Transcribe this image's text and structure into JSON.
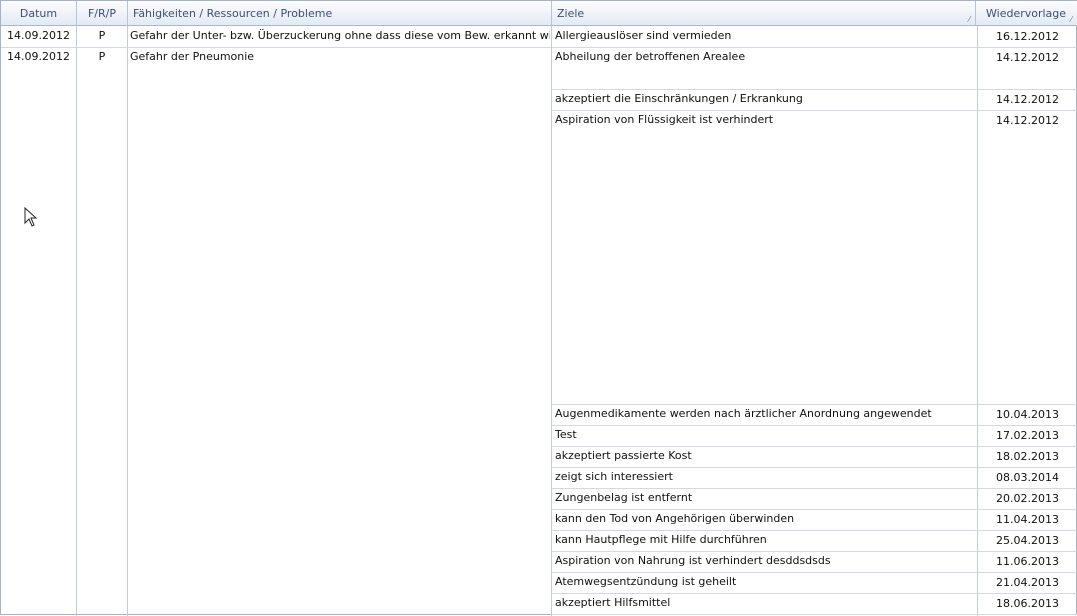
{
  "columns": {
    "datum": "Datum",
    "frp": "F/R/P",
    "problems": "Fähigkeiten / Ressourcen / Probleme",
    "ziele": "Ziele",
    "wiedervorlage": "Wiedervorlage"
  },
  "rows": [
    {
      "datum": "14.09.2012",
      "frp": "P",
      "problem": "Gefahr der Unter- bzw. Überzuckerung ohne dass diese vom Bew. erkannt wird"
    },
    {
      "datum": "14.09.2012",
      "frp": "P",
      "problem": "Gefahr der Pneumonie"
    }
  ],
  "goals": [
    {
      "ziel": "Allergieauslöser sind vermieden",
      "datum": "16.12.2012"
    },
    {
      "ziel": "Abheilung der betroffenen Arealee",
      "datum": "14.12.2012"
    },
    {
      "ziel": "akzeptiert die Einschränkungen / Erkrankung",
      "datum": "14.12.2012"
    },
    {
      "ziel": "Aspiration von Flüssigkeit ist verhindert",
      "datum": "14.12.2012"
    },
    {
      "ziel": "Augenmedikamente werden nach ärztlicher Anordnung angewendet",
      "datum": "10.04.2013"
    },
    {
      "ziel": "Test",
      "datum": "17.02.2013"
    },
    {
      "ziel": "akzeptiert passierte Kost",
      "datum": "18.02.2013"
    },
    {
      "ziel": "zeigt sich interessiert",
      "datum": "08.03.2014"
    },
    {
      "ziel": "Zungenbelag ist entfernt",
      "datum": "20.02.2013"
    },
    {
      "ziel": "kann den Tod von Angehörigen überwinden",
      "datum": "11.04.2013"
    },
    {
      "ziel": "kann Hautpflege mit Hilfe durchführen",
      "datum": "25.04.2013"
    },
    {
      "ziel": "Aspiration von Nahrung ist verhindert desddsdsds",
      "datum": "11.06.2013"
    },
    {
      "ziel": "Atemwegsentzündung ist geheilt",
      "datum": "21.04.2013"
    },
    {
      "ziel": "akzeptiert Hilfsmittel",
      "datum": "18.06.2013"
    }
  ],
  "icons": {
    "sort": "sort-glyph",
    "cursor": "mouse-pointer-icon"
  },
  "colors": {
    "header_text": "#3a5275",
    "grid_line": "#c3ccd7"
  }
}
